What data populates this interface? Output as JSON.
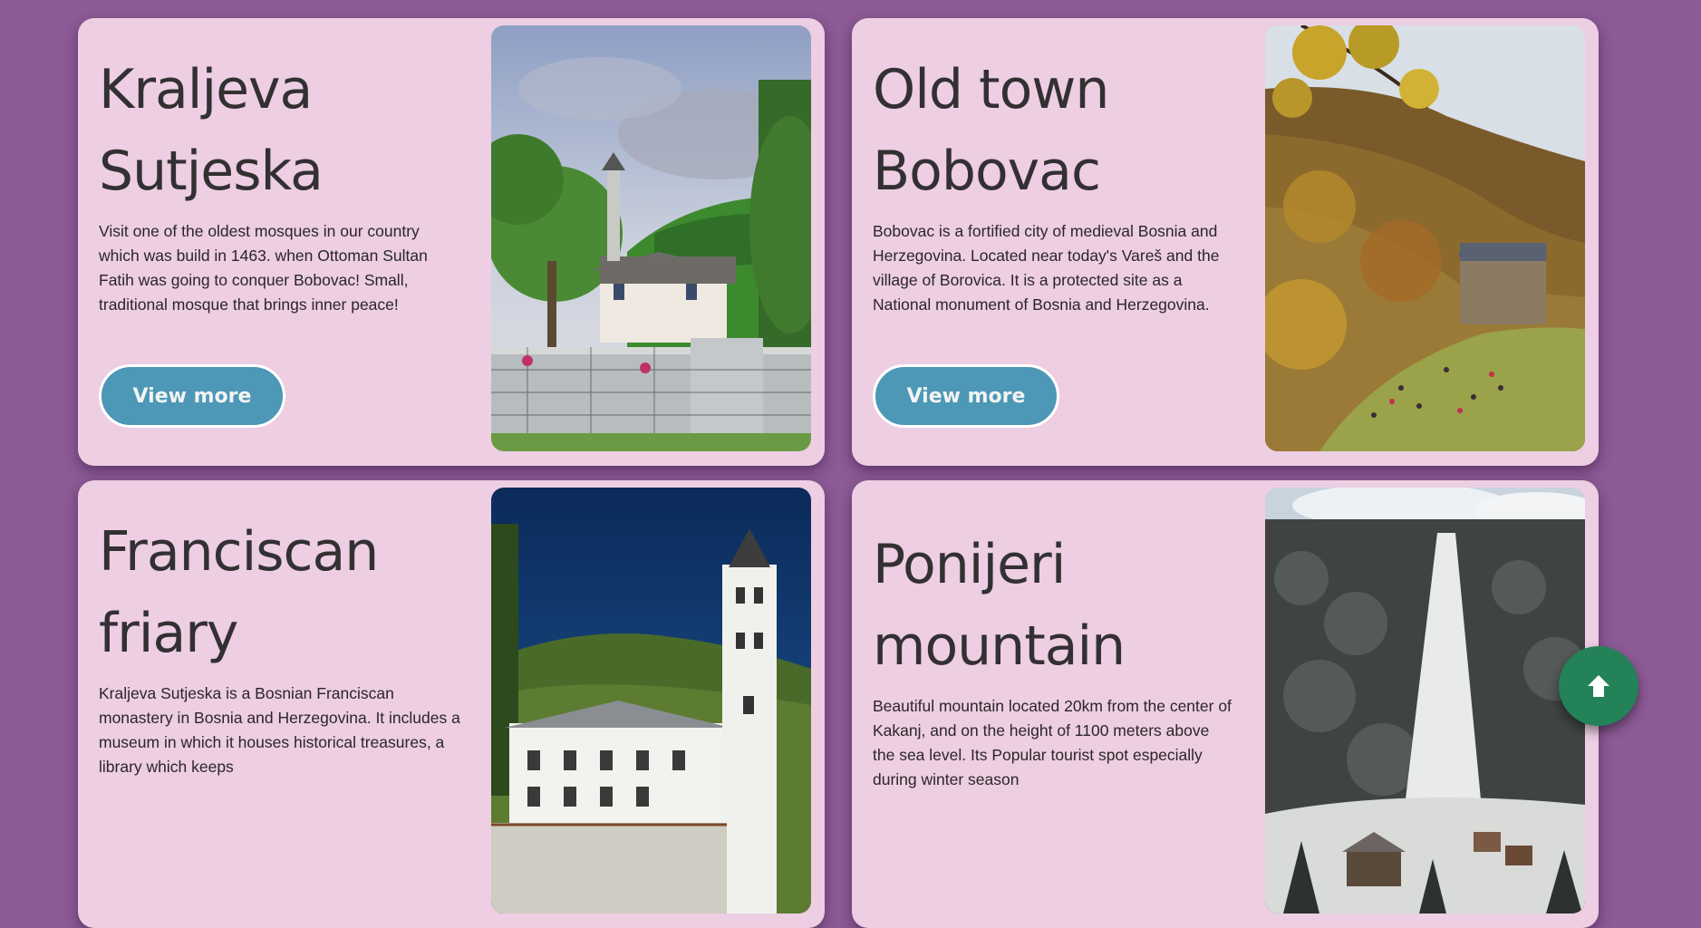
{
  "cards": [
    {
      "title_line1": "Kraljeva",
      "title_line2": "Sutjeska",
      "description": "Visit one of the oldest mosques in our country which was build in 1463. when Ottoman Sultan Fatih was going to conquer Bobovac! Small, traditional mosque that brings inner peace!",
      "button_label": "View more"
    },
    {
      "title_line1": "Old town",
      "title_line2": "Bobovac",
      "description": "Bobovac is a fortified city of medieval Bosnia and Herzegovina. Located near today's Vareš and the village of Borovica. It is a protected site as a National monument of Bosnia and Herzegovina.",
      "button_label": "View more"
    },
    {
      "title_line1": "Franciscan",
      "title_line2": "friary",
      "description": "Kraljeva Sutjeska is a Bosnian Franciscan monastery in Bosnia and Herzegovina. It includes a museum in which it houses historical treasures, a library which keeps"
    },
    {
      "title_line1": "Ponijeri",
      "title_line2": "mountain",
      "description": "Beautiful mountain located 20km from the center of Kakanj, and on the height of 1100 meters above the sea level. Its Popular tourist spot especially during winter season"
    }
  ],
  "scroll_top": {
    "icon": "arrow-up-icon"
  },
  "colors": {
    "background": "#8c5a96",
    "card": "#edcee2",
    "button": "#4c98b6",
    "scroll_button": "#238257"
  }
}
